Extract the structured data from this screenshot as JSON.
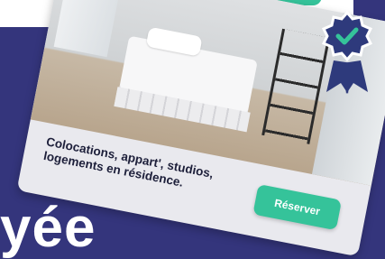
{
  "listing_card": {
    "caption_line1": "Colocations, appart', studios,",
    "caption_line2": "logements en résidence.",
    "reserve_label": "Réserver"
  },
  "hero": {
    "partial_heading": "yée"
  },
  "colors": {
    "background": "#34357c",
    "accent_green": "#35c39a",
    "badge_navy": "#2e3a7c"
  },
  "icons": {
    "badge": "verified-badge-icon",
    "check": "checkmark-icon"
  }
}
